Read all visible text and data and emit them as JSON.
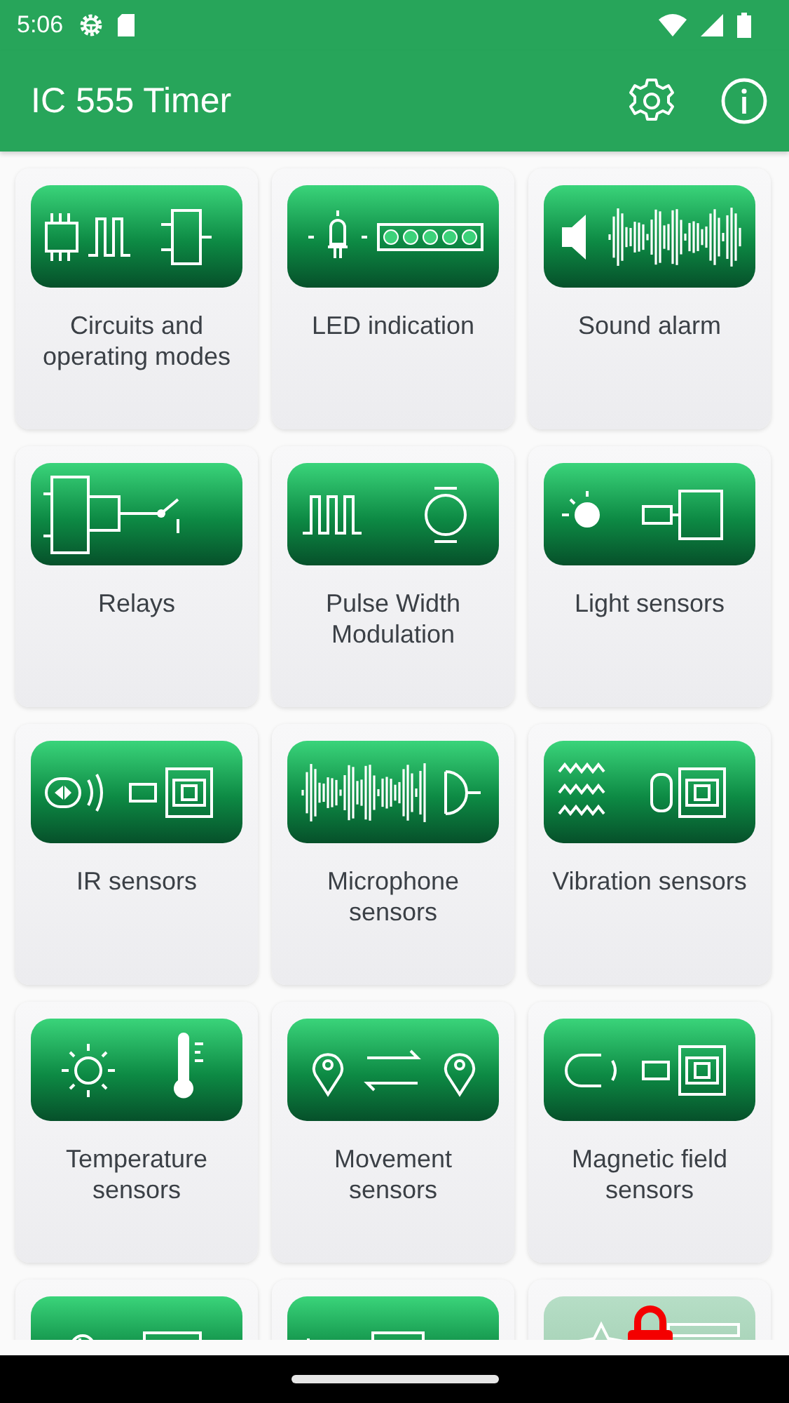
{
  "status_bar": {
    "time": "5:06"
  },
  "app_bar": {
    "title": "IC 555 Timer"
  },
  "cards": [
    {
      "label": "Circuits and operating modes",
      "locked": false
    },
    {
      "label": "LED indication",
      "locked": false
    },
    {
      "label": "Sound alarm",
      "locked": false
    },
    {
      "label": "Relays",
      "locked": false
    },
    {
      "label": "Pulse Width Modulation",
      "locked": false
    },
    {
      "label": "Light sensors",
      "locked": false
    },
    {
      "label": "IR sensors",
      "locked": false
    },
    {
      "label": "Microphone sensors",
      "locked": false
    },
    {
      "label": "Vibration sensors",
      "locked": false
    },
    {
      "label": "Temperature sensors",
      "locked": false
    },
    {
      "label": "Movement sensors",
      "locked": false
    },
    {
      "label": "Magnetic field sensors",
      "locked": false
    },
    {
      "locked": false
    },
    {
      "locked": false
    },
    {
      "locked": true
    }
  ]
}
